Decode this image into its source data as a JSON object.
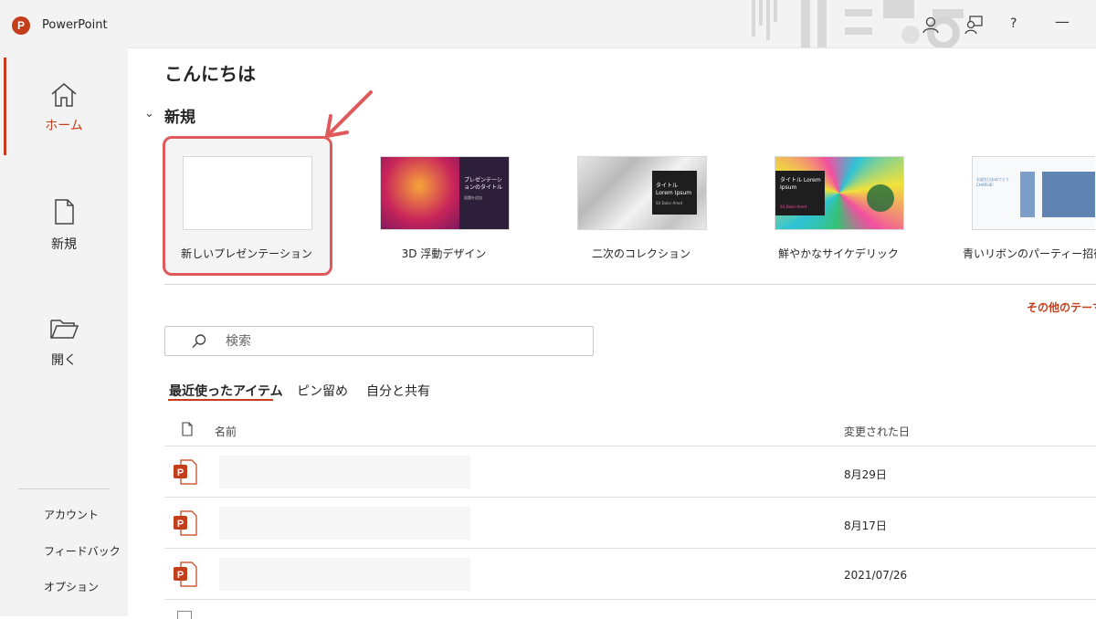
{
  "app": {
    "logo_letter": "P",
    "title": "PowerPoint"
  },
  "titlebar": {
    "help": "?",
    "minimize": "—"
  },
  "sidebar": {
    "items": [
      {
        "label": "ホーム",
        "icon": "home-icon",
        "active": true
      },
      {
        "label": "新規",
        "icon": "new-document-icon"
      },
      {
        "label": "開く",
        "icon": "open-folder-icon"
      }
    ],
    "footer": [
      {
        "label": "アカウント"
      },
      {
        "label": "フィードバック"
      },
      {
        "label": "オプション"
      }
    ]
  },
  "main": {
    "greeting": "こんにちは",
    "new_section": {
      "title": "新規",
      "templates": [
        {
          "label": "新しいプレゼンテーション"
        },
        {
          "label": "3D 浮動デザイン",
          "thumb_text": "プレゼンテーションのタイトル",
          "thumb_sub": "副題を追加"
        },
        {
          "label": "二次のコレクション",
          "thumb_text": "タイトル Lorem Ipsum",
          "thumb_sub": "Sit Dolor Amet"
        },
        {
          "label": "鮮やかなサイケデリック",
          "thumb_text": "タイトル Lorem Ipsum",
          "thumb_sub": "Sit Dolor Amet"
        },
        {
          "label": "青いリボンのパーティー招待状",
          "thumb_text": "お誕生日おめでとう CHARLIE!"
        }
      ],
      "more_themes": "その他のテーマ"
    },
    "search": {
      "placeholder": "検索"
    },
    "tabs": [
      {
        "label": "最近使ったアイテム",
        "active": true
      },
      {
        "label": "ピン留め"
      },
      {
        "label": "自分と共有"
      }
    ],
    "columns": {
      "name": "名前",
      "modified": "変更された日"
    },
    "files": [
      {
        "date": "8月29日"
      },
      {
        "date": "8月17日"
      },
      {
        "date": "2021/07/26"
      }
    ]
  },
  "colors": {
    "accent": "#c43e1c",
    "highlight": "#e05a5c",
    "sidebar_bg": "#f3f3f3"
  }
}
